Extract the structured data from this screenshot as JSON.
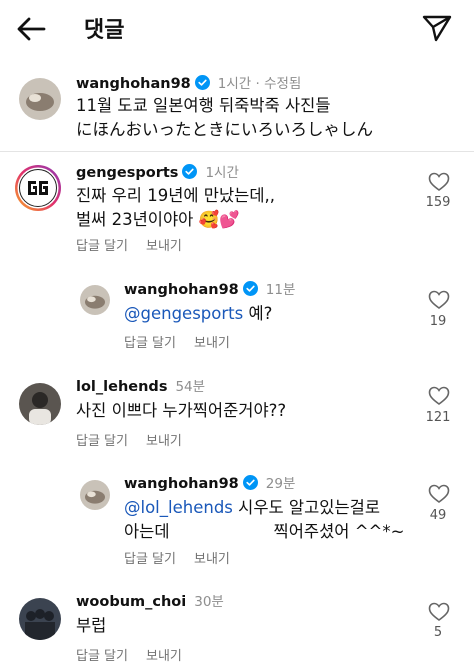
{
  "header": {
    "title": "댓글"
  },
  "comments": [
    {
      "username": "wanghohan98",
      "verified": true,
      "time": "1시간 · 수정됨",
      "lines": [
        "11월 도쿄 일본여행 뒤죽박죽 사진들",
        "にほんおいったときにいろいろしゃしん"
      ]
    },
    {
      "username": "gengesports",
      "verified": true,
      "time": "1시간",
      "lines": [
        "진짜 우리 19년에 만났는데,,",
        "벌써 23년이야아 🥰💕"
      ],
      "reply_label": "답글 달기",
      "send_label": "보내기",
      "likes": "159"
    },
    {
      "username": "wanghohan98",
      "verified": true,
      "time": "11분",
      "mention": "@gengesports",
      "text": " 예?",
      "reply_label": "답글 달기",
      "send_label": "보내기",
      "likes": "19"
    },
    {
      "username": "lol_lehends",
      "verified": false,
      "time": "54분",
      "lines": [
        "사진 이쁘다 누가찍어준거야??"
      ],
      "reply_label": "답글 달기",
      "send_label": "보내기",
      "likes": "121"
    },
    {
      "username": "wanghohan98",
      "verified": true,
      "time": "29분",
      "mention": "@lol_lehends",
      "text": " 시우도 알고있는걸로",
      "line2a": "아는데",
      "line2b": "찍어주셨어 ^^*~",
      "reply_label": "답글 달기",
      "send_label": "보내기",
      "likes": "49"
    },
    {
      "username": "woobum_choi",
      "verified": false,
      "time": "30분",
      "lines": [
        "부럽"
      ],
      "reply_label": "답글 달기",
      "send_label": "보내기",
      "likes": "5"
    }
  ],
  "colors": {
    "mention": "#1a58b9",
    "verified": "#0095f6",
    "muted": "#8e8e8e"
  },
  "icons": [
    "back-arrow-icon",
    "send-icon",
    "verified-icon",
    "heart-icon"
  ]
}
